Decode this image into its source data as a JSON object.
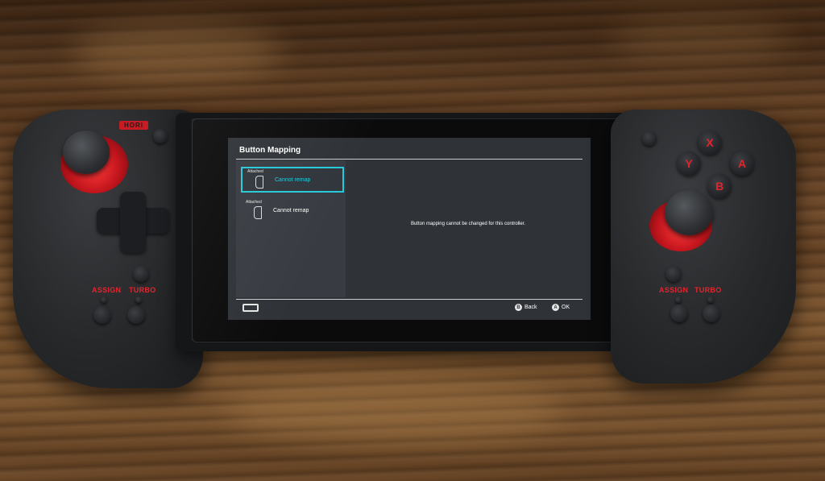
{
  "brand": {
    "logo_text": "HORI",
    "accent_color": "#e1252d"
  },
  "left_controller": {
    "assign_label": "ASSIGN",
    "turbo_label": "TURBO"
  },
  "right_controller": {
    "assign_label": "ASSIGN",
    "turbo_label": "TURBO",
    "face_buttons": {
      "x": "X",
      "y": "Y",
      "a": "A",
      "b": "B"
    }
  },
  "screen": {
    "title": "Button Mapping",
    "highlight_color": "#27c9d8",
    "controllers": [
      {
        "status": "Attached",
        "label": "Cannot remap",
        "selected": true
      },
      {
        "status": "Attached",
        "label": "Cannot remap",
        "selected": false
      }
    ],
    "message": "Button mapping cannot be changed for this controller.",
    "footer": {
      "back_label": "Back",
      "back_glyph": "B",
      "ok_label": "OK",
      "ok_glyph": "A"
    }
  }
}
